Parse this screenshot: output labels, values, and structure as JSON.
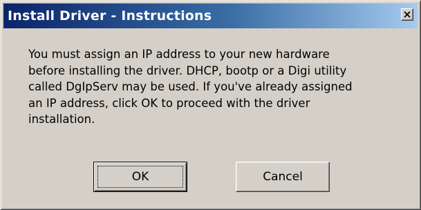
{
  "window": {
    "title": "Install Driver - Instructions",
    "close_icon": "close-icon"
  },
  "message": {
    "lines": [
      "You must assign an IP address to your new hardware",
      "before installing the driver.  DHCP, bootp or a  Digi utility",
      "called DgIpServ may be used.  If you've already assigned",
      "an IP address, click OK to proceed with the driver",
      "installation."
    ]
  },
  "buttons": {
    "ok_label": "OK",
    "cancel_label": "Cancel"
  },
  "colors": {
    "titlebar_start": "#0a246a",
    "titlebar_end": "#a6caf0",
    "face": "#d4d0c8"
  }
}
